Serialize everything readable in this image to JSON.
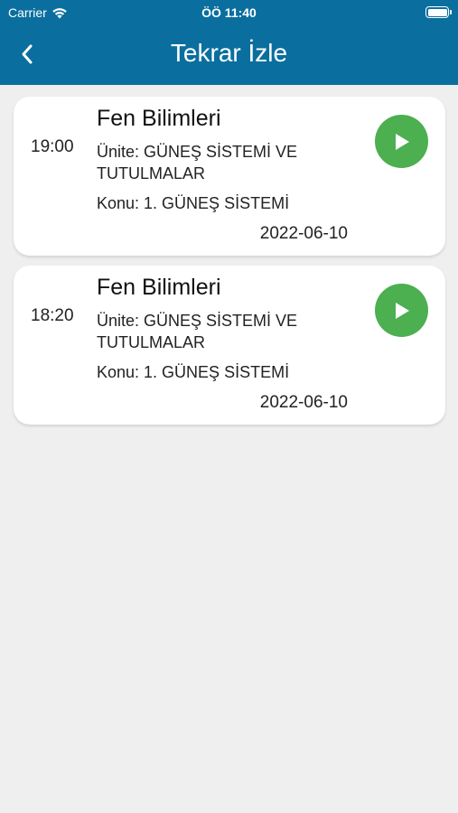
{
  "status_bar": {
    "carrier": "Carrier",
    "time": "ÖÖ 11:40"
  },
  "nav": {
    "title": "Tekrar İzle",
    "back_icon": "chevron-left-icon"
  },
  "colors": {
    "header": "#0a6f9e",
    "play": "#4caf50",
    "background": "#efefef"
  },
  "recordings": [
    {
      "time": "19:00",
      "subject": "Fen Bilimleri",
      "unit": "Ünite: GÜNEŞ SİSTEMİ VE TUTULMALAR",
      "topic": "Konu: 1. GÜNEŞ SİSTEMİ",
      "date": "2022-06-10"
    },
    {
      "time": "18:20",
      "subject": "Fen Bilimleri",
      "unit": "Ünite: GÜNEŞ SİSTEMİ VE TUTULMALAR",
      "topic": "Konu: 1. GÜNEŞ SİSTEMİ",
      "date": "2022-06-10"
    }
  ]
}
